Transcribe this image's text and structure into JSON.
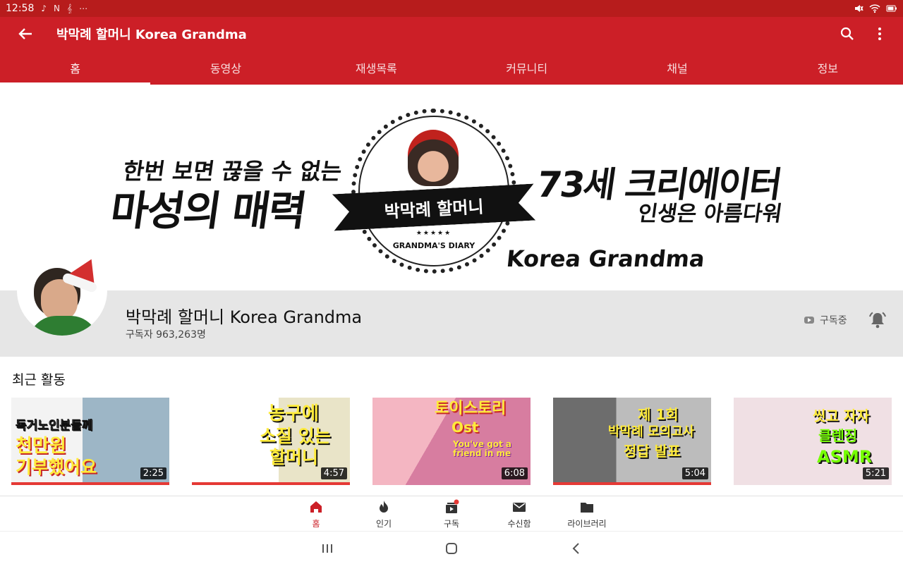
{
  "status_bar": {
    "time": "12:58",
    "left_icons": [
      "♪",
      "N",
      "𝄞",
      "⋯"
    ]
  },
  "app_bar": {
    "title": "박막례 할머니 Korea Grandma"
  },
  "tabs": [
    {
      "label": "홈"
    },
    {
      "label": "동영상"
    },
    {
      "label": "재생목록"
    },
    {
      "label": "커뮤니티"
    },
    {
      "label": "채널"
    },
    {
      "label": "정보"
    }
  ],
  "banner": {
    "left_line1": "한번 보면 끊을 수 없는",
    "left_line2": "마성의 매력",
    "right_line1": "73세 크리에이터",
    "right_line2": "인생은 아름다워",
    "ribbon": "박막례 할머니",
    "stars": "★★★★★",
    "diary": "GRANDMA'S DIARY",
    "english": "Korea Grandma"
  },
  "channel": {
    "name": "박막례 할머니 Korea Grandma",
    "subscribers": "구독자 963,263명",
    "subscribed_label": "구독중"
  },
  "recent": {
    "title": "최근 활동",
    "videos": [
      {
        "caption1": "독거노인분들께",
        "caption2": "천만원",
        "caption3": "기부했어요",
        "duration": "2:25"
      },
      {
        "caption1": "농구에",
        "caption2": "소질 있는",
        "caption3": "할머니",
        "duration": "4:57"
      },
      {
        "caption1": "토이스토리",
        "caption2": "Ost",
        "caption3": "You've got a friend in me",
        "duration": "6:08"
      },
      {
        "caption1": "제 1회",
        "caption2": "박막례 모의고사",
        "caption3": "정답 발표",
        "duration": "5:04"
      },
      {
        "caption1": "씻고 자자",
        "caption2": "클렌징",
        "caption3": "ASMR",
        "duration": "5:21"
      }
    ]
  },
  "bottom_nav": [
    {
      "label": "홈",
      "icon": "home-icon"
    },
    {
      "label": "인기",
      "icon": "fire-icon"
    },
    {
      "label": "구독",
      "icon": "subscriptions-icon"
    },
    {
      "label": "수신함",
      "icon": "mail-icon"
    },
    {
      "label": "라이브러리",
      "icon": "folder-icon"
    }
  ],
  "colors": {
    "brand": "#cc1f27",
    "status_bar": "#b71c1c"
  }
}
